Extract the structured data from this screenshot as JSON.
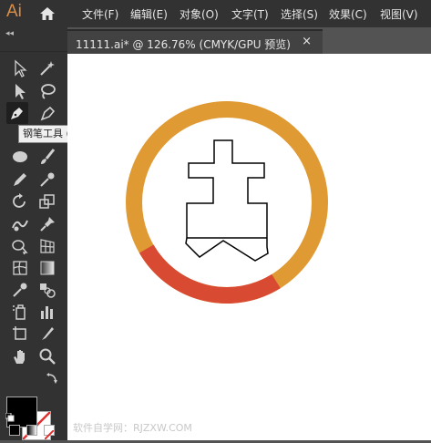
{
  "app": {
    "logo": "Ai"
  },
  "menu": [
    "文件(F)",
    "编辑(E)",
    "对象(O)",
    "文字(T)",
    "选择(S)",
    "效果(C)",
    "视图(V)"
  ],
  "document_tab": {
    "label": "11111.ai* @ 126.76% (CMYK/GPU 预览)",
    "close": "×"
  },
  "toolbar": {
    "collapse": "◂◂"
  },
  "tooltip": "钢笔工具 (P)",
  "watermark": "软件自学网：RJZXW.COM",
  "colors": {
    "ring_orange": "#e09a33",
    "ring_red": "#d94a33",
    "fill": "#000000",
    "stroke": "#ffffff"
  },
  "tools": [
    "selection-tool",
    "direct-selection-tool",
    "magic-wand-tool",
    "lasso-tool",
    "pen-tool",
    "curvature-tool",
    "ellipse-tool",
    "paintbrush-tool",
    "pencil-tool",
    "shaper-tool",
    "rotate-tool",
    "scale-tool",
    "warp-tool",
    "puppet-warp-tool",
    "shape-builder-tool",
    "perspective-grid-tool",
    "mesh-tool",
    "gradient-tool",
    "eyedropper-tool",
    "blend-tool",
    "symbol-sprayer-tool",
    "graph-tool",
    "artboard-tool",
    "slice-tool",
    "hand-tool",
    "zoom-tool"
  ]
}
